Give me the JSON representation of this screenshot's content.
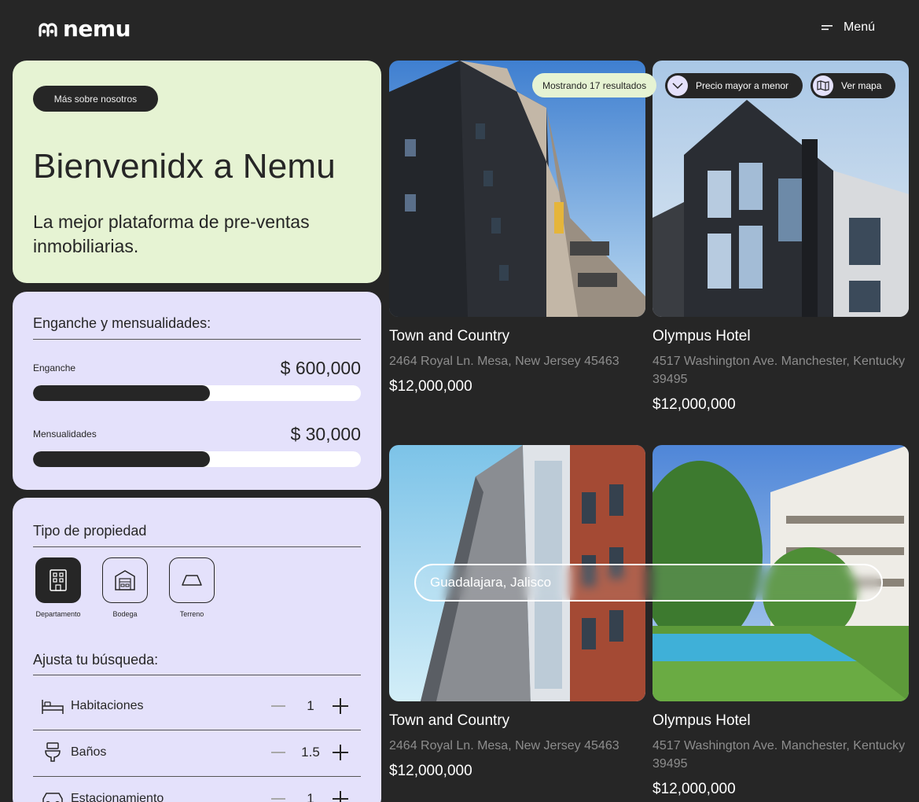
{
  "header": {
    "logo_text": "nemu",
    "menu_label": "Menú"
  },
  "welcome": {
    "about_button": "Más sobre nosotros",
    "title": "Bienvenidx a Nemu",
    "subtitle": "La mejor plataforma de pre-ventas inmobiliarias."
  },
  "finance": {
    "title": "Enganche y mensualidades:",
    "down_payment": {
      "label": "Enganche",
      "currency": "$",
      "value": "600,000",
      "fill_fraction": 0.54
    },
    "monthly": {
      "label": "Mensualidades",
      "currency": "$",
      "value": "30,000",
      "fill_fraction": 0.54
    }
  },
  "filters": {
    "property_type_title": "Tipo de propiedad",
    "property_types": [
      {
        "label": "Departamento",
        "icon": "building-icon",
        "selected": true
      },
      {
        "label": "Bodega",
        "icon": "warehouse-icon",
        "selected": false
      },
      {
        "label": "Terreno",
        "icon": "land-icon",
        "selected": false
      }
    ],
    "adjust_title": "Ajusta tu búsqueda:",
    "steppers": [
      {
        "label": "Habitaciones",
        "icon": "bed-icon",
        "value": "1"
      },
      {
        "label": "Baños",
        "icon": "toilet-icon",
        "value": "1.5"
      },
      {
        "label": "Estacionamiento",
        "icon": "car-icon",
        "value": "1"
      }
    ]
  },
  "toolbar": {
    "results_text": "Mostrando 17 resultados",
    "sort_label": "Precio mayor a menor",
    "map_label": "Ver mapa"
  },
  "search": {
    "value": "Guadalajara, Jalisco"
  },
  "properties": [
    {
      "name": "Town and Country",
      "address": "2464 Royal Ln. Mesa, New Jersey 45463",
      "price": "$12,000,000"
    },
    {
      "name": "Olympus Hotel",
      "address": "4517 Washington Ave. Manchester, Kentucky 39495",
      "price": "$12,000,000"
    },
    {
      "name": "Town and Country",
      "address": "2464 Royal Ln. Mesa, New Jersey 45463",
      "price": "$12,000,000"
    },
    {
      "name": "Olympus Hotel",
      "address": "4517 Washington Ave. Manchester, Kentucky 39495",
      "price": "$12,000,000"
    }
  ],
  "colors": {
    "background": "#262626",
    "welcome_card": "#e6f3d3",
    "filter_card": "#e4e1fb",
    "muted_text": "#8d8d8d"
  }
}
